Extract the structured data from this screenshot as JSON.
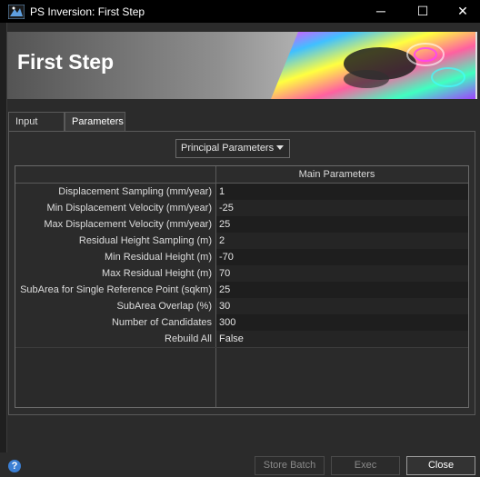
{
  "window": {
    "title": "PS Inversion: First Step",
    "minimize_glyph": "─",
    "maximize_glyph": "☐",
    "close_glyph": "✕"
  },
  "banner": {
    "title": "First Step"
  },
  "tabs": [
    {
      "label": "Input Files",
      "active": false
    },
    {
      "label": "Parameters",
      "active": true
    }
  ],
  "parameters": {
    "section_selected": "Principal Parameters",
    "column_header": "Main Parameters",
    "rows": [
      {
        "label": "Displacement Sampling (mm/year)",
        "value": "1"
      },
      {
        "label": "Min Displacement Velocity (mm/year)",
        "value": "-25"
      },
      {
        "label": "Max Displacement Velocity (mm/year)",
        "value": "25"
      },
      {
        "label": "Residual Height Sampling (m)",
        "value": "2"
      },
      {
        "label": "Min Residual Height (m)",
        "value": "-70"
      },
      {
        "label": "Max Residual Height (m)",
        "value": "70"
      },
      {
        "label": "SubArea for Single Reference Point (sqkm)",
        "value": "25"
      },
      {
        "label": "SubArea Overlap (%)",
        "value": "30"
      },
      {
        "label": "Number of Candidates",
        "value": "300"
      },
      {
        "label": "Rebuild All",
        "value": "False"
      }
    ]
  },
  "footer": {
    "help": "?",
    "store_batch": "Store Batch",
    "exec": "Exec",
    "close": "Close"
  },
  "colors": {
    "background": "#2b2b2b",
    "titlebar": "#000000",
    "help_blue": "#3b7fd4"
  }
}
